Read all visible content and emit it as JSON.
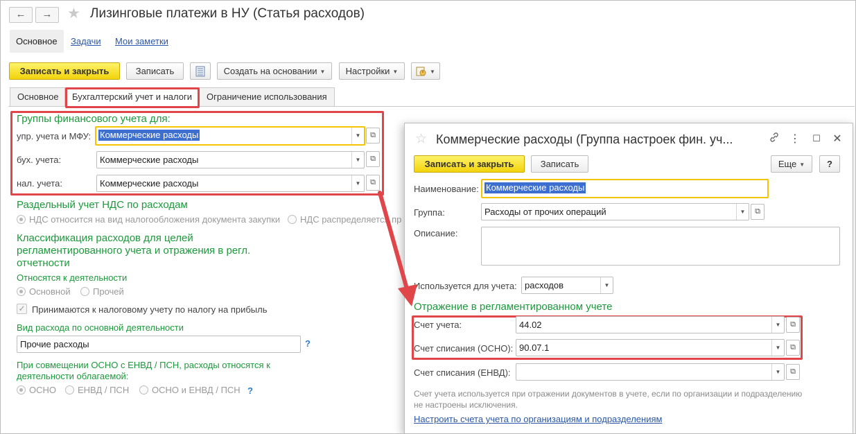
{
  "header": {
    "title": "Лизинговые платежи в НУ (Статья расходов)",
    "back_glyph": "←",
    "forward_glyph": "→",
    "tabs": [
      {
        "label": "Основное"
      },
      {
        "label": "Задачи"
      },
      {
        "label": "Мои заметки"
      }
    ]
  },
  "toolbar": {
    "save_close": "Записать и закрыть",
    "save": "Записать",
    "create_based": "Создать на основании",
    "settings": "Настройки"
  },
  "inner_tabs": [
    {
      "label": "Основное"
    },
    {
      "label": "Бухгалтерский учет и налоги"
    },
    {
      "label": "Ограничение использования"
    }
  ],
  "fin_groups": {
    "heading": "Группы финансового учета для:",
    "rows": [
      {
        "label": "упр. учета и МФУ:",
        "value": "Коммерческие расходы"
      },
      {
        "label": "бух. учета:",
        "value": "Коммерческие расходы"
      },
      {
        "label": "нал. учета:",
        "value": "Коммерческие расходы"
      }
    ]
  },
  "vat": {
    "heading": "Раздельный учет НДС по расходам",
    "option1": "НДС относится на вид налогообложения документа закупки",
    "option2": "НДС распределяется пр"
  },
  "classification": {
    "heading_line1": "Классификация расходов для целей",
    "heading_line2": "регламентированного учета и отражения в регл.",
    "heading_line3": "отчетности",
    "activity_label": "Относятся к деятельности",
    "activity_main": "Основной",
    "activity_other": "Прочей",
    "profit_tax": "Принимаются к налоговому учету по налогу на прибыль",
    "expense_kind_label": "Вид расхода по основной деятельности",
    "expense_kind_value": "Прочие расходы",
    "combo_label_line1": "При совмещении ОСНО с ЕНВД / ПСН, расходы относятся к",
    "combo_label_line2": "деятельности облагаемой:",
    "combo_osno": "ОСНО",
    "combo_envd": "ЕНВД / ПСН",
    "combo_both": "ОСНО и ЕНВД / ПСН",
    "help": "?"
  },
  "modal": {
    "title": "Коммерческие расходы (Группа настроек фин. уч...",
    "save_close": "Записать и закрыть",
    "save": "Записать",
    "more": "Еще",
    "help": "?",
    "name_label": "Наименование:",
    "name_value": "Коммерческие расходы",
    "group_label": "Группа:",
    "group_value": "Расходы от прочих операций",
    "desc_label": "Описание:",
    "desc_value": "",
    "used_for_label": "Используется для учета:",
    "used_for_value": "расходов",
    "reg_heading": "Отражение в регламентированном учете",
    "account_label": "Счет учета:",
    "account_value": "44.02",
    "writeoff_osno_label": "Счет списания (ОСНО):",
    "writeoff_osno_value": "90.07.1",
    "writeoff_envd_label": "Счет списания (ЕНВД):",
    "writeoff_envd_value": "",
    "note_line1": "Счет учета используется при отражении документов в учете, если по организации и подразделению",
    "note_line2": "не настроены исключения.",
    "link": "Настроить счета учета по организациям и подразделениям"
  },
  "colors": {
    "accent_green": "#1c9a3b",
    "highlight_red": "#e0454a",
    "button_yellow": "#f2d30b",
    "link_blue": "#2a57a8"
  }
}
